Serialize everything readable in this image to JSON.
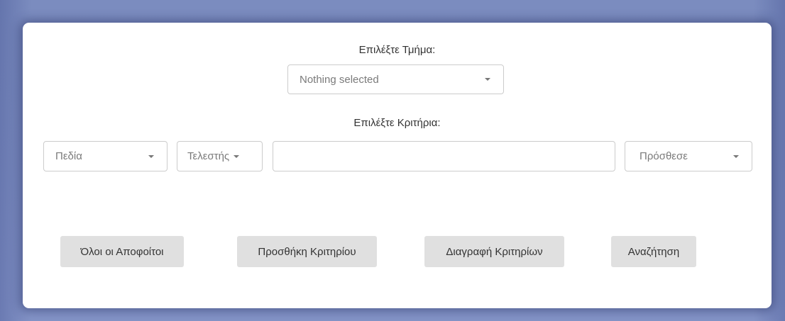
{
  "department": {
    "label": "Επιλέξτε Τμήμα:",
    "selected": "Nothing selected"
  },
  "criteria": {
    "label": "Επιλέξτε Κριτήρια:",
    "fields_select": "Πεδία",
    "operator_select": "Τελεστής",
    "value_input": "",
    "add_select": "Πρόσθεσε"
  },
  "buttons": {
    "all_graduates": "Όλοι οι Αποφοίτοι",
    "add_criterion": "Προσθήκη Κριτηρίου",
    "delete_criteria": "Διαγραφή Κριτηρίων",
    "search": "Αναζήτηση"
  },
  "colors": {
    "background": "#7f8fc2",
    "card": "#ffffff",
    "button": "#e0e0e0",
    "border": "#cccccc"
  }
}
